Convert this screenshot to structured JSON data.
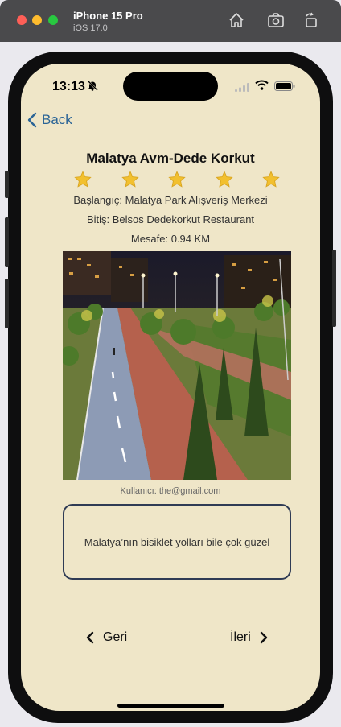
{
  "simulator": {
    "device_name": "iPhone 15 Pro",
    "os_version": "iOS 17.0",
    "toolbar_icons": [
      "home-icon",
      "screenshot-icon",
      "rotate-icon"
    ]
  },
  "status_bar": {
    "time": "13:13",
    "icons": [
      "bell-slash-icon",
      "signal-icon",
      "wifi-icon",
      "battery-icon"
    ]
  },
  "nav": {
    "back_label": "Back"
  },
  "route": {
    "title": "Malatya Avm-Dede Korkut",
    "rating": 5,
    "rating_max": 5,
    "start": "Başlangıç: Malatya Park Alışveriş Merkezi",
    "end": "Bitiş: Belsos Dedekorkut Restaurant",
    "distance": "Mesafe: 0.94 KM",
    "user": "Kullanıcı: the@gmail.com",
    "comment": "Malatya’nın bisiklet yolları bile çok güzel"
  },
  "pager": {
    "prev_label": "Geri",
    "next_label": "İleri"
  },
  "colors": {
    "screen_bg": "#efe6c8",
    "back_link": "#2a6496",
    "star": "#f2c02f",
    "comment_border": "#2f3b55"
  }
}
